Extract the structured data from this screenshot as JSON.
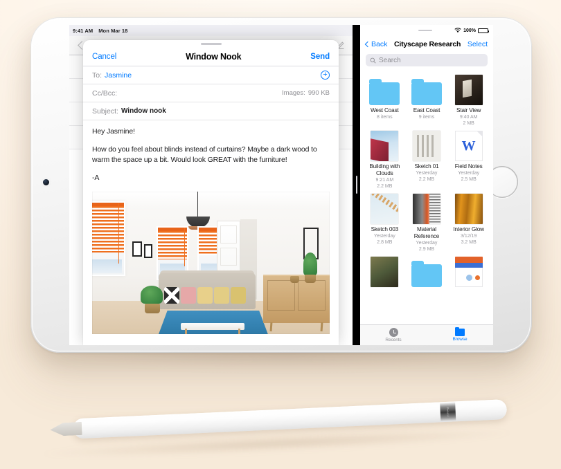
{
  "device": {
    "name": "iPad",
    "camera_label": "front-camera",
    "home_button_label": "Home"
  },
  "mail": {
    "status_bar": {
      "time": "9:41 AM",
      "date": "Mon Mar 18"
    },
    "nav": {
      "back_icon": "chevron-left-icon",
      "compose_icon": "compose-icon"
    },
    "sheet": {
      "cancel_label": "Cancel",
      "title": "Window Nook",
      "send_label": "Send",
      "fields": {
        "to_label": "To:",
        "to_value": "Jasmine",
        "add_contact_icon": "plus-circle-icon",
        "ccbcc_label": "Cc/Bcc:",
        "images_label": "Images:",
        "images_size": "990 KB",
        "subject_label": "Subject:",
        "subject_value": "Window nook"
      },
      "body": {
        "greeting": "Hey Jasmine!",
        "paragraph": "How do you feel about blinds instead of curtains? Maybe a dark wood to warm the space up a bit. Would look GREAT with the furniture!",
        "signature": "-A"
      },
      "attachment_alt": "living room photo with orange window blinds"
    }
  },
  "split_divider": {
    "name": "split-view-divider"
  },
  "files": {
    "status_bar": {
      "wifi_icon": "wifi-icon",
      "battery_pct": "100%",
      "battery_icon": "battery-icon"
    },
    "nav": {
      "back_label": "Back",
      "title": "Cityscape Research",
      "select_label": "Select"
    },
    "search": {
      "placeholder": "Search",
      "icon": "search-icon"
    },
    "items": [
      {
        "name": "West Coast",
        "meta1": "8 items",
        "meta2": "",
        "kind": "folder"
      },
      {
        "name": "East Coast",
        "meta1": "9 items",
        "meta2": "",
        "kind": "folder"
      },
      {
        "name": "Stair View",
        "meta1": "9:40 AM",
        "meta2": "2 MB",
        "kind": "image-stair"
      },
      {
        "name": "Building with Clouds",
        "meta1": "9:21 AM",
        "meta2": "2.2 MB",
        "kind": "image-building"
      },
      {
        "name": "Sketch 01",
        "meta1": "Yesterday",
        "meta2": "2.2 MB",
        "kind": "image-sketch01"
      },
      {
        "name": "Field Notes",
        "meta1": "Yesterday",
        "meta2": "2.5 MB",
        "kind": "doc-word"
      },
      {
        "name": "Sketch 003",
        "meta1": "Yesterday",
        "meta2": "2.8 MB",
        "kind": "image-sketch003"
      },
      {
        "name": "Material Reference",
        "meta1": "Yesterday",
        "meta2": "2.9 MB",
        "kind": "image-material"
      },
      {
        "name": "Interior Glow",
        "meta1": "3/12/19",
        "meta2": "3.2 MB",
        "kind": "image-interior"
      },
      {
        "name": "",
        "meta1": "",
        "meta2": "",
        "kind": "image-book"
      },
      {
        "name": "",
        "meta1": "",
        "meta2": "",
        "kind": "folder"
      },
      {
        "name": "",
        "meta1": "",
        "meta2": "",
        "kind": "doc-chart"
      }
    ],
    "tabs": [
      {
        "label": "Recents",
        "icon": "clock-icon",
        "active": false
      },
      {
        "label": "Browse",
        "icon": "folder-icon",
        "active": true
      }
    ]
  },
  "pencil": {
    "name": "Apple Pencil",
    "band_text": "Pencil"
  },
  "colors": {
    "accent_blue": "#007aff",
    "folder_blue": "#63c6f5",
    "background": "#fdf3e8",
    "blind_orange": "#ef6f1e"
  }
}
